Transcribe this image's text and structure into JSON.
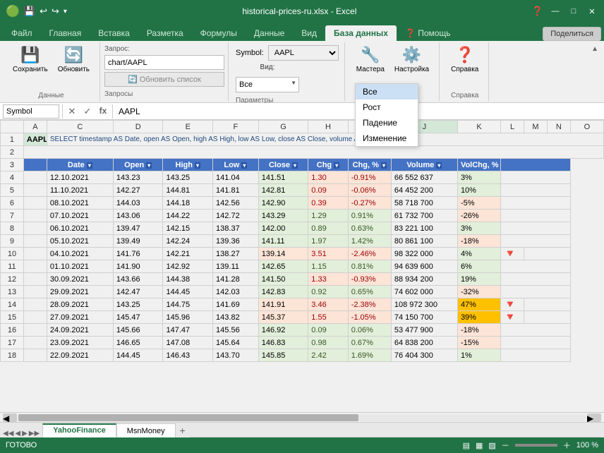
{
  "titlebar": {
    "title": "historical-prices-ru.xlsx - Excel",
    "save_icon": "💾",
    "undo_icon": "↩",
    "redo_icon": "↪",
    "minimize": "🗕",
    "maximize": "🗖",
    "close": "✕"
  },
  "ribbon_tabs": [
    "Файл",
    "Главная",
    "Вставка",
    "Разметка",
    "Формулы",
    "Данные",
    "Вид",
    "База данных",
    "Помощь"
  ],
  "active_tab": "База данных",
  "ribbon_groups": {
    "data": {
      "label": "Данные",
      "buttons": [
        "Сохранить",
        "Обновить"
      ]
    },
    "queries": {
      "label": "Запросы",
      "query_label": "Запрос:",
      "query_value": "chart/AAPL",
      "update_btn": "Обновить список"
    },
    "params": {
      "label": "Параметры",
      "symbol_label": "Symbol:",
      "symbol_value": "AAPL",
      "vid_label": "Вид:",
      "vid_value": "Все",
      "vid_options": [
        "Все",
        "Рост",
        "Падение",
        "Изменение"
      ]
    },
    "settings": {
      "label": "Настройка",
      "buttons": [
        "Мастера",
        "Настройка"
      ]
    },
    "help": {
      "label": "Справка",
      "buttons": [
        "Справка"
      ]
    },
    "share": "Поделиться"
  },
  "formula_bar": {
    "name_box": "Symbol",
    "value": "AAPL"
  },
  "dropdown": {
    "visible": true,
    "options": [
      "Все",
      "Рост",
      "Падение",
      "Изменение"
    ],
    "selected": "Все"
  },
  "row1": {
    "aapl": "AAPL",
    "sql": "SELECT timestamp AS Date, open AS Open, high AS High, low AS Low, close AS Close, volume AS Volume"
  },
  "headers": [
    "Date",
    "Open",
    "High",
    "Low",
    "Close",
    "Chg",
    "Chg, %",
    "Volume",
    "VolChg, %"
  ],
  "rows": [
    {
      "date": "12.10.2021",
      "open": "143.23",
      "high": "143.25",
      "low": "141.04",
      "close": "141.51",
      "chg": "1.30",
      "chg_pct": "-0.91%",
      "volume": "66 552 637",
      "vol_chg": "3%",
      "close_color": "green",
      "chg_color": "red"
    },
    {
      "date": "11.10.2021",
      "open": "142.27",
      "high": "144.81",
      "low": "141.81",
      "close": "142.81",
      "chg": "0.09",
      "chg_pct": "-0.06%",
      "volume": "64 452 200",
      "vol_chg": "10%",
      "close_color": "green",
      "chg_color": "red"
    },
    {
      "date": "08.10.2021",
      "open": "144.03",
      "high": "144.18",
      "low": "142.56",
      "close": "142.90",
      "chg": "0.39",
      "chg_pct": "-0.27%",
      "volume": "58 718 700",
      "vol_chg": "-5%",
      "close_color": "green",
      "chg_color": "red"
    },
    {
      "date": "07.10.2021",
      "open": "143.06",
      "high": "144.22",
      "low": "142.72",
      "close": "143.29",
      "chg": "1.29",
      "chg_pct": "0.91%",
      "volume": "61 732 700",
      "vol_chg": "-26%",
      "close_color": "green",
      "chg_color": "green"
    },
    {
      "date": "06.10.2021",
      "open": "139.47",
      "high": "142.15",
      "low": "138.37",
      "close": "142.00",
      "chg": "0.89",
      "chg_pct": "0.63%",
      "volume": "83 221 100",
      "vol_chg": "3%",
      "close_color": "green",
      "chg_color": "green"
    },
    {
      "date": "05.10.2021",
      "open": "139.49",
      "high": "142.24",
      "low": "139.36",
      "close": "141.11",
      "chg": "1.97",
      "chg_pct": "1.42%",
      "volume": "80 861 100",
      "vol_chg": "-18%",
      "close_color": "green",
      "chg_color": "green"
    },
    {
      "date": "04.10.2021",
      "open": "141.76",
      "high": "142.21",
      "low": "138.27",
      "close": "139.14",
      "chg": "3.51",
      "chg_pct": "-2.46%",
      "volume": "98 322 000",
      "vol_chg": "4%",
      "close_color": "red",
      "chg_color": "red",
      "arrow": true
    },
    {
      "date": "01.10.2021",
      "open": "141.90",
      "high": "142.92",
      "low": "139.11",
      "close": "142.65",
      "chg": "1.15",
      "chg_pct": "0.81%",
      "volume": "94 639 600",
      "vol_chg": "6%",
      "close_color": "green",
      "chg_color": "green"
    },
    {
      "date": "30.09.2021",
      "open": "143.66",
      "high": "144.38",
      "low": "141.28",
      "close": "141.50",
      "chg": "1.33",
      "chg_pct": "-0.93%",
      "volume": "88 934 200",
      "vol_chg": "19%",
      "close_color": "green",
      "chg_color": "red"
    },
    {
      "date": "29.09.2021",
      "open": "142.47",
      "high": "144.45",
      "low": "142.03",
      "close": "142.83",
      "chg": "0.92",
      "chg_pct": "0.65%",
      "volume": "74 602 000",
      "vol_chg": "-32%",
      "close_color": "green",
      "chg_color": "green"
    },
    {
      "date": "28.09.2021",
      "open": "143.25",
      "high": "144.75",
      "low": "141.69",
      "close": "141.91",
      "chg": "3.46",
      "chg_pct": "-2.38%",
      "volume": "108 972 300",
      "vol_chg": "47%",
      "close_color": "red",
      "chg_color": "red",
      "arrow": true
    },
    {
      "date": "27.09.2021",
      "open": "145.47",
      "high": "145.96",
      "low": "143.82",
      "close": "145.37",
      "chg": "1.55",
      "chg_pct": "-1.05%",
      "volume": "74 150 700",
      "vol_chg": "39%",
      "close_color": "red",
      "chg_color": "red",
      "arrow": true
    },
    {
      "date": "24.09.2021",
      "open": "145.66",
      "high": "147.47",
      "low": "145.56",
      "close": "146.92",
      "chg": "0.09",
      "chg_pct": "0.06%",
      "volume": "53 477 900",
      "vol_chg": "-18%",
      "close_color": "green",
      "chg_color": "green"
    },
    {
      "date": "23.09.2021",
      "open": "146.65",
      "high": "147.08",
      "low": "145.64",
      "close": "146.83",
      "chg": "0.98",
      "chg_pct": "0.67%",
      "volume": "64 838 200",
      "vol_chg": "-15%",
      "close_color": "green",
      "chg_color": "green"
    },
    {
      "date": "22.09.2021",
      "open": "144.45",
      "high": "146.43",
      "low": "143.70",
      "close": "145.85",
      "chg": "2.42",
      "chg_pct": "1.69%",
      "volume": "76 404 300",
      "vol_chg": "1%",
      "close_color": "green",
      "chg_color": "green"
    }
  ],
  "tabs": [
    "YahooFinance",
    "MsnMoney"
  ],
  "active_sheet": "YahooFinance",
  "status": "ГОТОВО",
  "zoom": "100 %"
}
